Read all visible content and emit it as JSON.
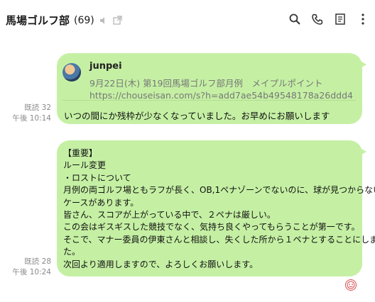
{
  "header": {
    "title": "馬場ゴルフ部",
    "count": "(69)",
    "icons": [
      "speaker-muted-icon",
      "external-window-icon",
      "search-icon",
      "phone-icon",
      "note-icon",
      "more-vertical-icon"
    ]
  },
  "messages": [
    {
      "read": "既読 32",
      "time": "午後 10:14",
      "preview": {
        "name": "junpei",
        "title": "9月22日(木) 第19回馬場ゴルフ部月例　メイプルポイント",
        "url": "https://chouseisan.com/s?h=add7ae54b49548178a26ddd46a..."
      },
      "text": "いつの間にか残枠が少なくなっていました。お早めにお願いします"
    },
    {
      "read": "既読 28",
      "time": "午後 10:24",
      "lines": [
        "【重要】",
        "ルール変更",
        "・ロストについて",
        "月例の両ゴルフ場ともラフが長く、OB,1ペナゾーンでないのに、球が見つからない",
        "ケースがあります。",
        "皆さん、スコアが上がっている中で、２ペナは厳しい。",
        "この会はギスギスした競技でなく、気持ち良くやってもらうことが第一です。",
        "そこで、マナー委員の伊東さんと相談し、失くした所から１ペナとすることにしまし",
        "た。",
        "次回より適用しますので、よろしくお願いします。"
      ],
      "reaction": "reaction-face-icon"
    }
  ],
  "colors": {
    "bubble": "#c5f0a4",
    "meta": "#8a8a8a",
    "reaction": "#d85050"
  }
}
